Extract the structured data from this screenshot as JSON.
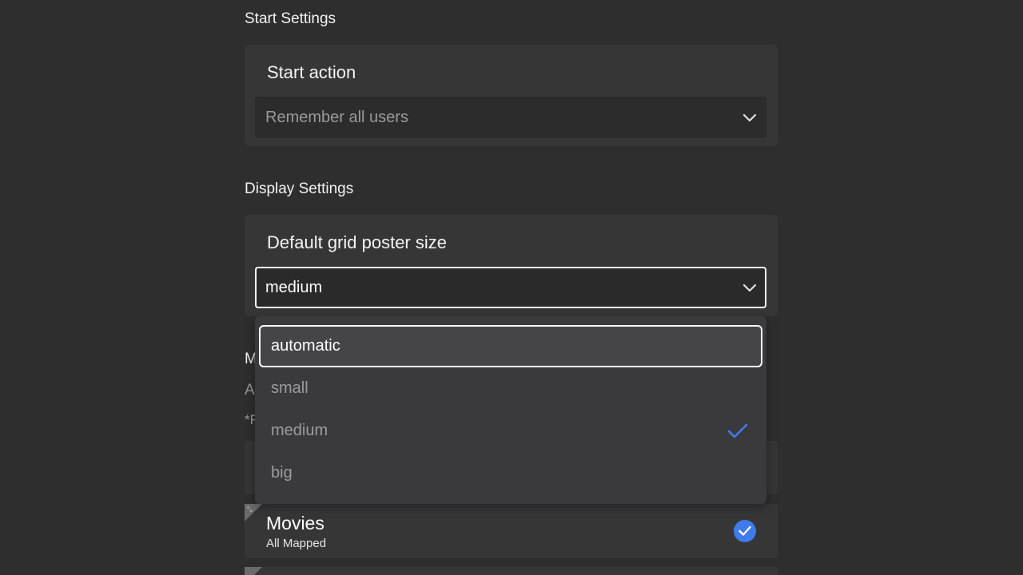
{
  "start_settings": {
    "heading": "Start Settings",
    "start_action": {
      "label": "Start action",
      "value": "Remember all users"
    }
  },
  "display_settings": {
    "heading": "Display Settings",
    "poster_size": {
      "label": "Default grid poster size",
      "value": "medium"
    }
  },
  "hidden_section": {
    "heading_fragment": "M",
    "text_fragment": "A",
    "note_fragment": "*F"
  },
  "dropdown": {
    "options": [
      {
        "label": "automatic",
        "focused": true,
        "selected": false
      },
      {
        "label": "small",
        "focused": false,
        "selected": false
      },
      {
        "label": "medium",
        "focused": false,
        "selected": true
      },
      {
        "label": "big",
        "focused": false,
        "selected": false
      }
    ]
  },
  "libraries": [
    {
      "title": "Movies",
      "subtitle": "All Mapped",
      "checked": true
    }
  ],
  "colors": {
    "background": "#2e2e2e",
    "card": "#363636",
    "accent": "#3f7bea",
    "focus_border": "#ffffff"
  }
}
